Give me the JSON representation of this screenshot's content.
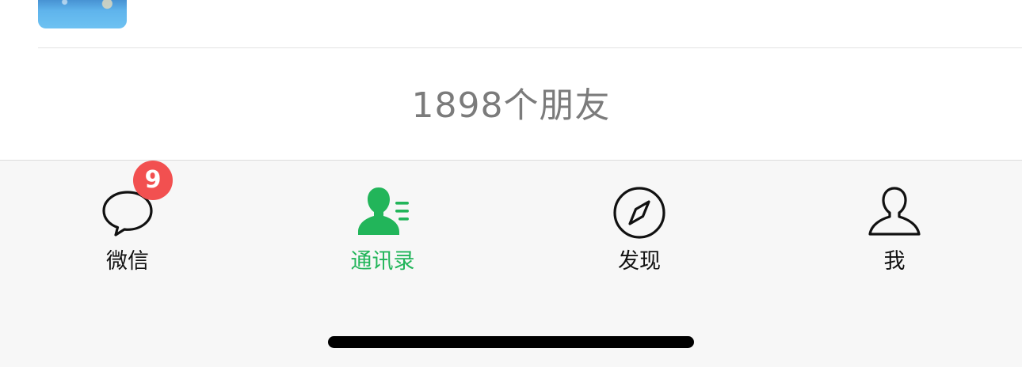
{
  "contacts": {
    "friend_count_text": "1898个朋友"
  },
  "tabbar": {
    "active_color": "#22b55a",
    "badge_color": "#f25050",
    "tabs": [
      {
        "label": "微信",
        "icon": "chat-bubble-icon",
        "badge": "9",
        "active": false
      },
      {
        "label": "通讯录",
        "icon": "contacts-icon",
        "active": true
      },
      {
        "label": "发现",
        "icon": "compass-icon",
        "active": false
      },
      {
        "label": "我",
        "icon": "person-icon",
        "active": false
      }
    ]
  }
}
